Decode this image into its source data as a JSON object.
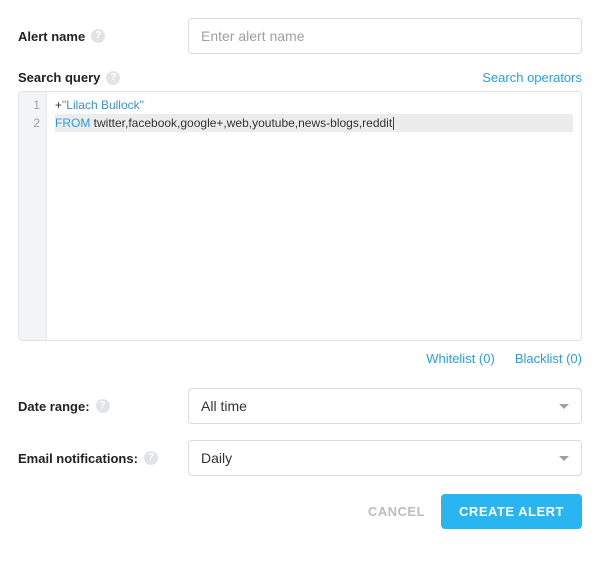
{
  "alertName": {
    "label": "Alert name",
    "placeholder": "Enter alert name",
    "value": ""
  },
  "searchQuery": {
    "label": "Search query",
    "operatorsLink": "Search operators",
    "lines": [
      {
        "n": "1",
        "plus": "+",
        "string": "\"Lilach Bullock\""
      },
      {
        "n": "2",
        "keyword": "FROM",
        "rest": " twitter,facebook,google+,web,youtube,news-blogs,reddit"
      }
    ]
  },
  "lists": {
    "whitelistLabel": "Whitelist (0)",
    "blacklistLabel": "Blacklist (0)"
  },
  "dateRange": {
    "label": "Date range:",
    "value": "All time"
  },
  "emailNotifications": {
    "label": "Email notifications:",
    "value": "Daily"
  },
  "buttons": {
    "cancel": "CANCEL",
    "create": "CREATE ALERT"
  }
}
